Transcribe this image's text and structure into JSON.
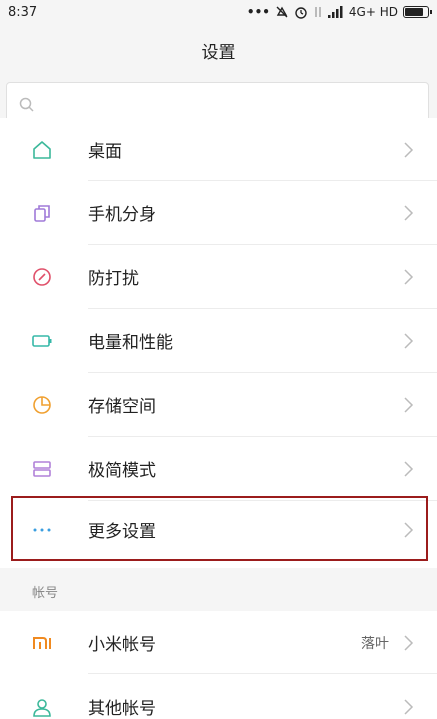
{
  "status_bar": {
    "time": "8:37",
    "indicators": "… ",
    "network": "4G+ HD"
  },
  "header": {
    "title": "设置"
  },
  "search": {
    "placeholder": ""
  },
  "items": [
    {
      "label": "桌面",
      "icon": "home-icon",
      "color": "#3bb89a"
    },
    {
      "label": "手机分身",
      "icon": "clone-icon",
      "color": "#a07ad8"
    },
    {
      "label": "防打扰",
      "icon": "dnd-icon",
      "color": "#e0506a"
    },
    {
      "label": "电量和性能",
      "icon": "battery-icon",
      "color": "#36b8a8"
    },
    {
      "label": "存储空间",
      "icon": "storage-pie-icon",
      "color": "#f0a030"
    },
    {
      "label": "极简模式",
      "icon": "simple-mode-icon",
      "color": "#b080d8"
    },
    {
      "label": "更多设置",
      "icon": "more-dots-icon",
      "color": "#3a9ee0"
    }
  ],
  "accounts_section": {
    "header": "帐号",
    "items": [
      {
        "label": "小米帐号",
        "icon": "mi-logo-icon",
        "color": "#f08a20",
        "trail": "落叶"
      },
      {
        "label": "其他帐号",
        "icon": "person-icon",
        "color": "#3bb89a"
      }
    ]
  },
  "highlight_color": "#9b1c1c"
}
